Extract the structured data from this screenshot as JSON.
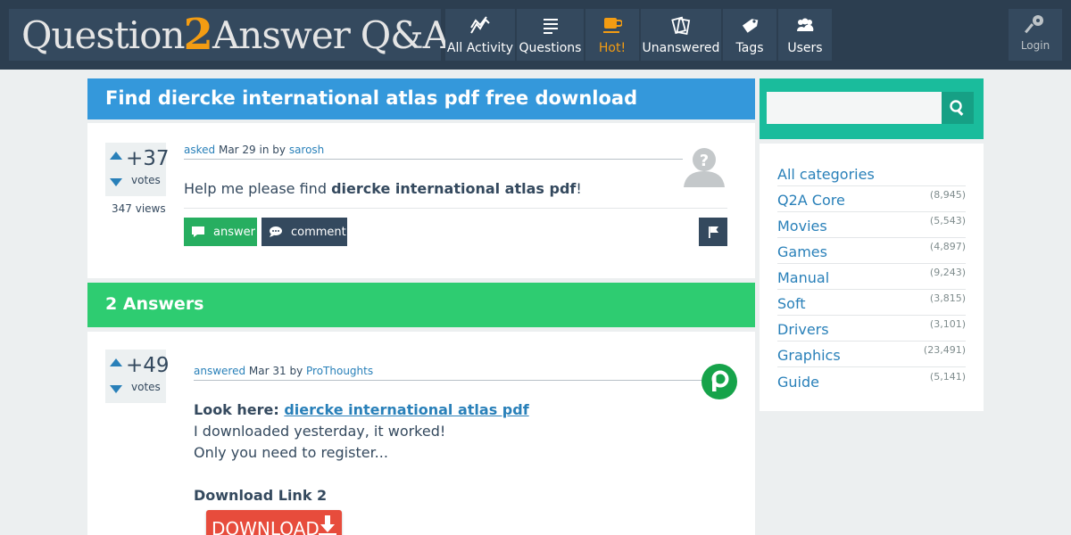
{
  "header": {
    "logo_part1": "Question",
    "logo_part2": "2",
    "logo_part3": "Answer",
    "logo_part4": "Q&A",
    "nav": [
      {
        "label": "All Activity",
        "icon": "activity-icon"
      },
      {
        "label": "Questions",
        "icon": "list-icon"
      },
      {
        "label": "Hot!",
        "icon": "coffee-cup-icon"
      },
      {
        "label": "Unanswered",
        "icon": "cards-icon"
      },
      {
        "label": "Tags",
        "icon": "tag-icon"
      },
      {
        "label": "Users",
        "icon": "users-icon"
      }
    ],
    "login_label": "Login"
  },
  "question": {
    "title": "Find diercke international atlas pdf free download",
    "votes": "+37",
    "votes_label": "votes",
    "views": "347 views",
    "meta": {
      "asked": "asked",
      "date": "Mar 29",
      "in_by": " in by ",
      "author": "sarosh"
    },
    "body_prefix": "Help me please find ",
    "body_bold": "diercke international atlas pdf",
    "body_suffix": "!",
    "answer_button": "answer",
    "comment_button": "comment"
  },
  "answers": {
    "heading": "2 Answers",
    "first": {
      "votes": "+49",
      "votes_label": "votes",
      "meta": {
        "answered": "answered",
        "date": "Mar 31",
        "by": " by ",
        "author": "ProThoughts"
      },
      "look_here": "Look here: ",
      "link_text": "diercke international atlas pdf",
      "line2": "I downloaded yesterday, it worked!",
      "line3": "Only you need to register...",
      "download_heading": "Download Link 2",
      "download_button": "DOWNLOAD"
    }
  },
  "sidebar": {
    "search_placeholder": "",
    "categories": [
      {
        "name": "All categories",
        "count": ""
      },
      {
        "name": "Q2A Core",
        "count": "(8,945)"
      },
      {
        "name": "Movies",
        "count": "(5,543)"
      },
      {
        "name": "Games",
        "count": "(4,897)"
      },
      {
        "name": "Manual",
        "count": "(9,243)"
      },
      {
        "name": "Soft",
        "count": "(3,815)"
      },
      {
        "name": "Drivers",
        "count": "(3,101)"
      },
      {
        "name": "Graphics",
        "count": "(23,491)"
      },
      {
        "name": "Guide",
        "count": "(5,141)"
      }
    ]
  },
  "colors": {
    "header_bg": "#2c3e50",
    "question_title_bg": "#3498db",
    "answers_title_bg": "#2ecc71",
    "search_bg": "#1abc9c",
    "hot_accent": "#f39c12",
    "link": "#2980b9",
    "download_red": "#e74c3c"
  }
}
